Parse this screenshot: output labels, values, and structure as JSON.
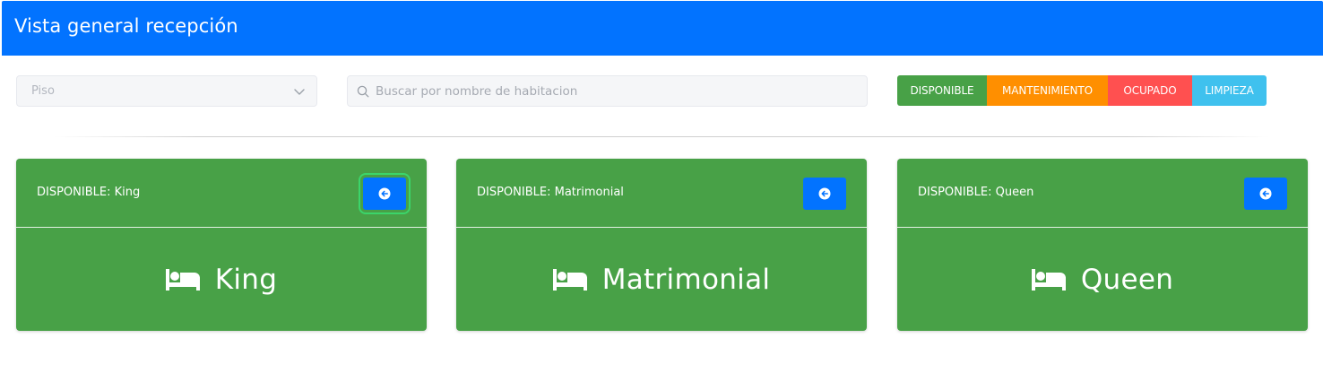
{
  "header": {
    "title": "Vista general recepción"
  },
  "filters": {
    "floor_select": {
      "placeholder": "Piso"
    },
    "search": {
      "placeholder": "Buscar por nombre de habitacion",
      "value": ""
    }
  },
  "status_legend": [
    {
      "label": "DISPONIBLE",
      "color": "#48a147"
    },
    {
      "label": "MANTENIMIENTO",
      "color": "#ff8f00"
    },
    {
      "label": "OCUPADO",
      "color": "#ff5050"
    },
    {
      "label": "LIMPIEZA",
      "color": "#3fc1ee"
    }
  ],
  "rooms": [
    {
      "status_text": "DISPONIBLE: King",
      "name": "King",
      "color": "#48a147",
      "action_icon": "arrow-circle-left-icon",
      "room_icon": "bed-icon"
    },
    {
      "status_text": "DISPONIBLE: Matrimonial",
      "name": "Matrimonial",
      "color": "#48a147",
      "action_icon": "arrow-circle-left-icon",
      "room_icon": "bed-icon"
    },
    {
      "status_text": "DISPONIBLE: Queen",
      "name": "Queen",
      "color": "#48a147",
      "action_icon": "arrow-circle-left-icon",
      "room_icon": "bed-icon"
    }
  ],
  "colors": {
    "header": "#0273ff",
    "action_button": "#0273ff",
    "focus_ring": "#3bd56a"
  }
}
